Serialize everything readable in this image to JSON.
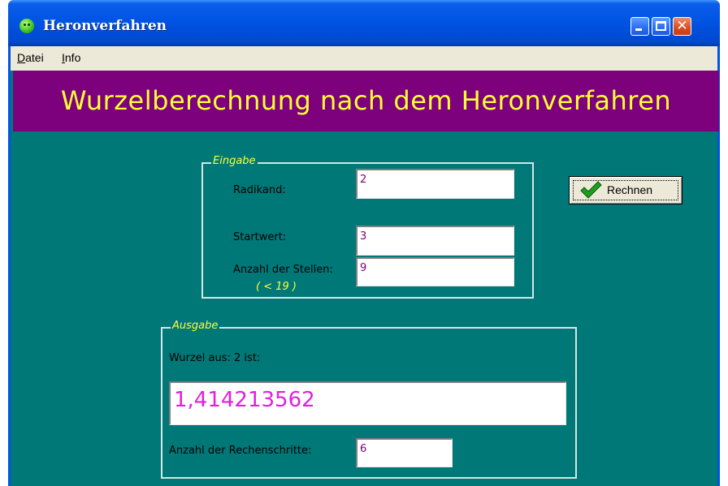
{
  "window": {
    "title": "Heronverfahren",
    "icon": "smiley-icon"
  },
  "menu": {
    "items": [
      {
        "label": "Datei",
        "underline": "D",
        "rest": "atei"
      },
      {
        "label": "Info",
        "underline": "I",
        "rest": "nfo"
      }
    ]
  },
  "banner": {
    "text": "Wurzelberechnung nach dem Heronverfahren"
  },
  "eingabe": {
    "legend": "Eingabe",
    "radikand_label": "Radikand:",
    "radikand_value": "2",
    "startwert_label": "Startwert:",
    "startwert_value": "3",
    "stellen_label": "Anzahl der Stellen:",
    "stellen_value": "9",
    "stellen_hint": "( < 19 )"
  },
  "button": {
    "label": "Rechnen",
    "icon": "checkmark-icon"
  },
  "ausgabe": {
    "legend": "Ausgabe",
    "result_label": "Wurzel aus: 2 ist:",
    "result_value": "1,414213562",
    "steps_label": "Anzahl der Rechenschritte:",
    "steps_value": "6"
  },
  "colors": {
    "background": "#007878",
    "banner": "#7d007d",
    "banner_text": "#ffff33",
    "field_text": "#80007f",
    "result_text": "#e020e0"
  }
}
